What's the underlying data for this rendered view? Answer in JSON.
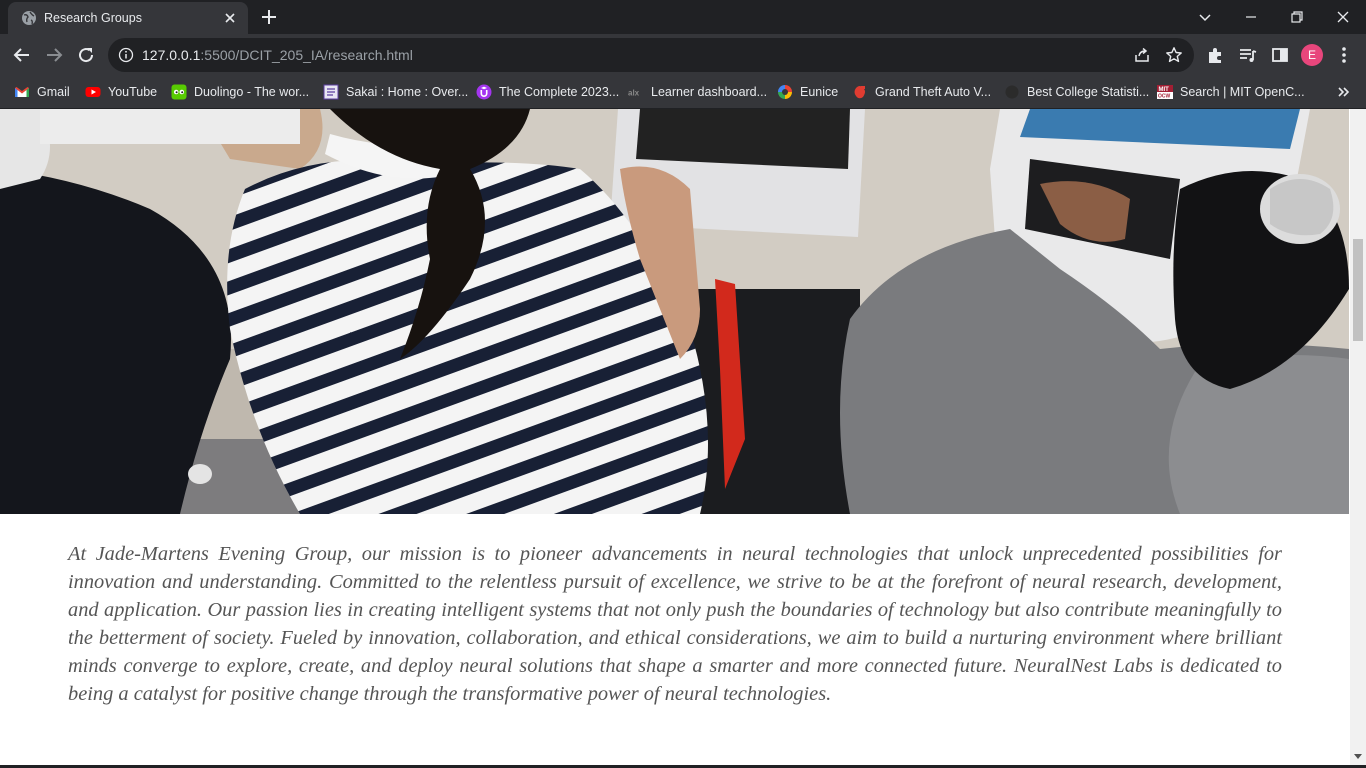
{
  "browser": {
    "tab": {
      "title": "Research Groups"
    },
    "url": {
      "host": "127.0.0.1",
      "rest": ":5500/DCIT_205_IA/research.html"
    },
    "profile_initial": "E"
  },
  "bookmarks": [
    {
      "label": "Gmail",
      "icon": "gmail-icon",
      "color": "#ea4335"
    },
    {
      "label": "YouTube",
      "icon": "youtube-icon",
      "color": "#ff0000"
    },
    {
      "label": "Duolingo - The wor...",
      "icon": "duolingo-icon",
      "color": "#58cc02"
    },
    {
      "label": "Sakai : Home : Over...",
      "icon": "sakai-icon",
      "color": "#5b3fa0"
    },
    {
      "label": "The Complete 2023...",
      "icon": "udemy-icon",
      "color": "#a435f0"
    },
    {
      "label": "Learner dashboard...",
      "icon": "alx-icon",
      "color": "#666666"
    },
    {
      "label": "Eunice",
      "icon": "swirl-icon",
      "color": "#4285f4"
    },
    {
      "label": "Grand Theft Auto V...",
      "icon": "gta-icon",
      "color": "#e03c31"
    },
    {
      "label": "Best College Statisti...",
      "icon": "globe-icon",
      "color": "#333333"
    },
    {
      "label": "Search | MIT OpenC...",
      "icon": "mit-ocw-icon",
      "color": "#a31f34"
    }
  ],
  "page": {
    "hero_image": "students-using-laptops-photo",
    "mission_text": "At Jade-Martens Evening Group, our mission is to pioneer advancements in neural technologies that unlock unprecedented possibilities for innovation and understanding. Committed to the relentless pursuit of excellence, we strive to be at the forefront of neural research, development, and application. Our passion lies in creating intelligent systems that not only push the boundaries of technology but also contribute meaningfully to the betterment of society. Fueled by innovation, collaboration, and ethical considerations, we aim to build a nurturing environment where brilliant minds converge to explore, create, and deploy neural solutions that shape a smarter and more connected future. NeuralNest Labs is dedicated to being a catalyst for positive change through the transformative power of neural technologies."
  }
}
